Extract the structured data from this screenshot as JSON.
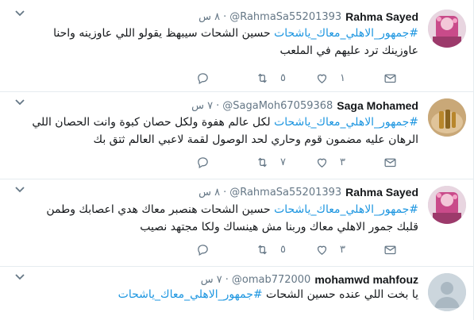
{
  "tweets": [
    {
      "name": "Rahma Sayed",
      "handle": "@RahmaSa55201393",
      "time": "٨ س",
      "hashtag": "#جمهور_الاهلي_معاك_ياشحات",
      "text": " حسين الشحات سيبهظ يقولو اللي عاوزينه واحنا عاوزينك ترد عليهم في الملعب",
      "replies": "",
      "retweets": "٥",
      "likes": "١",
      "avatar": "pink-avatar"
    },
    {
      "name": "Saga Mohamed",
      "handle": "@SagaMoh67059368",
      "time": "٧ س",
      "hashtag": "#جمهور_الاهلي_معاك_ياشحات",
      "text": " لكل عالم هفوة ولكل حصان كبوة وانت الحصان اللي الرهان عليه مضمون قوم وحاري لحد الوصول لقمة لاعبي العالم ثتق بك",
      "replies": "",
      "retweets": "٧",
      "likes": "٣",
      "avatar": "rings-avatar"
    },
    {
      "name": "Rahma Sayed",
      "handle": "@RahmaSa55201393",
      "time": "٨ س",
      "hashtag": "#جمهور_الاهلي_معاك_ياشحات",
      "text": " حسين الشحات هنصبر معاك هدي اعصابك وطمن قلبك جمور الاهلي معاك وربنا مش هينساك ولكا مجتهد نصيب",
      "replies": "",
      "retweets": "٥",
      "likes": "٣",
      "avatar": "pink-avatar"
    },
    {
      "name": "mohamwd mahfouz",
      "handle": "@omab772000",
      "time": "٧ س",
      "hashtag": "#جمهور_الاهلي_معاك_ياشحات",
      "text_before": "يا بخت اللي عنده حسين الشحات ",
      "replies": "",
      "retweets": "",
      "likes": "",
      "avatar": "default-avatar"
    }
  ],
  "colors": {
    "link": "#1b95e0",
    "muted": "#657786",
    "border": "#e6ecf0"
  }
}
